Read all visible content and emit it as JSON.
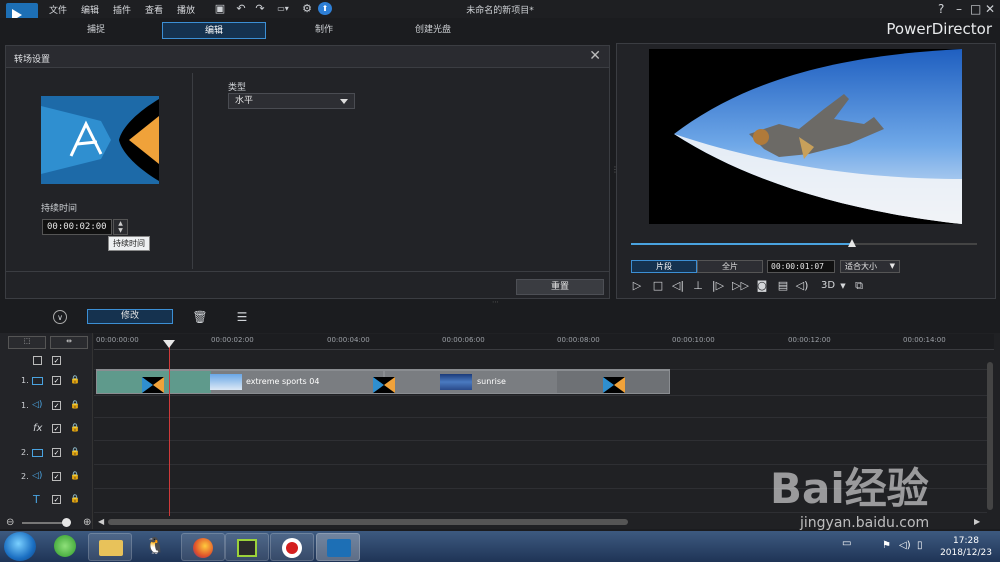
{
  "menu": [
    "文件",
    "编辑",
    "插件",
    "查看",
    "播放"
  ],
  "window_title": "未命名的新项目*",
  "tabs": [
    "捕捉",
    "编辑",
    "制作",
    "创建光盘"
  ],
  "brand": "PowerDirector",
  "panel": {
    "title": "转场设置",
    "duration_label": "持续时间",
    "duration_value": "00:00:02:00",
    "tooltip": "持续时间",
    "type_label": "类型",
    "type_value": "水平",
    "reset_label": "重置"
  },
  "preview": {
    "clip_btn": "片段",
    "full_btn": "全片",
    "timecode": "00:00:01:07",
    "fit_label": "适合大小",
    "mode_3d": "3D",
    "scrub_fraction": 0.64
  },
  "toolbar": {
    "edit_label": "修改"
  },
  "timeline": {
    "ticks": [
      "00:00:00:00",
      "00:00:02:00",
      "00:00:04:00",
      "00:00:06:00",
      "00:00:08:00",
      "00:00:10:00",
      "00:00:12:00",
      "00:00:14:00"
    ],
    "tracks": [
      "1.",
      "1.",
      "fx",
      "2.",
      "2.",
      "T"
    ],
    "clips": [
      {
        "name": "extreme sports 04"
      },
      {
        "name": "sunrise"
      }
    ]
  },
  "taskbar": {
    "time": "17:28",
    "date": "2018/12/23"
  },
  "watermark": {
    "brand": "Bai经验",
    "url": "jingyan.baidu.com"
  }
}
